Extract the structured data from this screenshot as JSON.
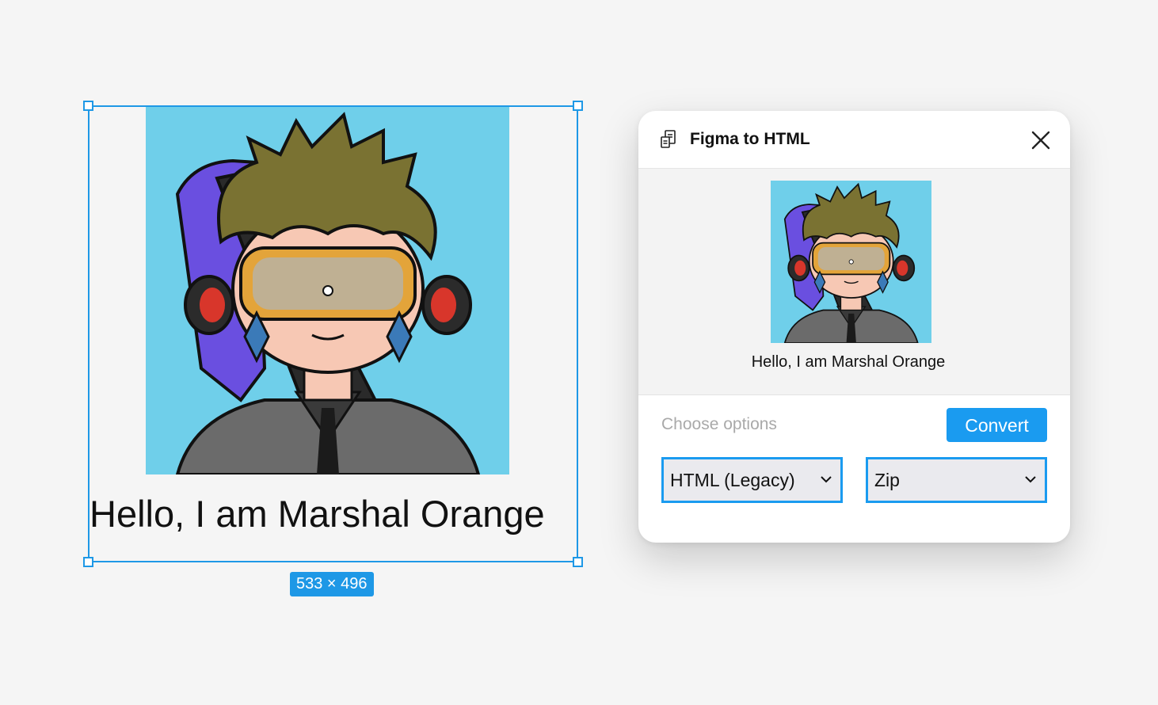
{
  "canvas": {
    "frame_caption": "Hello, I am Marshal Orange",
    "size_badge": "533 × 496",
    "avatar_bg_color": "#6fcfea",
    "selection_color": "#1e98e6"
  },
  "plugin": {
    "title": "Figma to HTML",
    "icon": "plugin-file-icon",
    "close_icon": "close-icon",
    "preview_caption": "Hello, I am Marshal Orange",
    "options_label": "Choose options",
    "convert_label": "Convert",
    "format_select": {
      "value": "HTML (Legacy)",
      "icon": "chevron-down-icon"
    },
    "output_select": {
      "value": "Zip",
      "icon": "chevron-down-icon"
    },
    "accent_color": "#1a9bf0"
  }
}
